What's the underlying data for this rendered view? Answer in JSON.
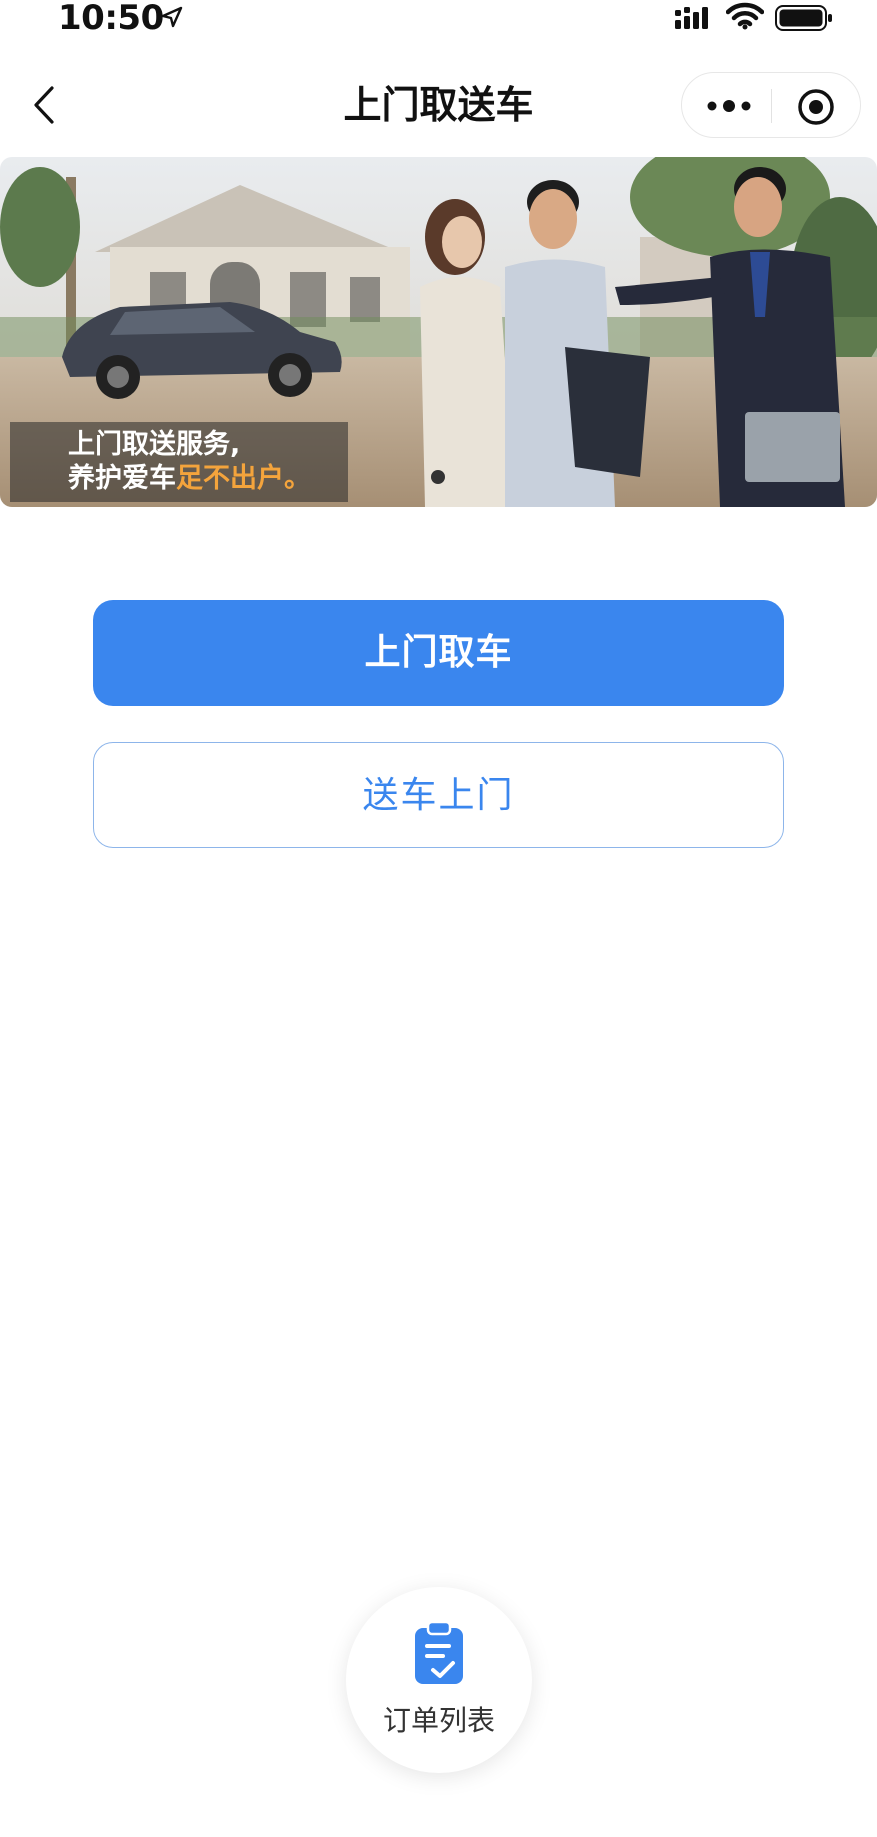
{
  "status_bar": {
    "time": "10:50"
  },
  "nav": {
    "title": "上门取送车"
  },
  "banner": {
    "caption_line1": "上门取送服务,",
    "caption_line2_white": "养护爱车",
    "caption_line2_highlight": "足不出户。",
    "highlight_color": "#f4a43c"
  },
  "actions": {
    "pickup_label": "上门取车",
    "delivery_label": "送车上门",
    "accent_color": "#3a86ee"
  },
  "footer": {
    "order_list_label": "订单列表"
  }
}
